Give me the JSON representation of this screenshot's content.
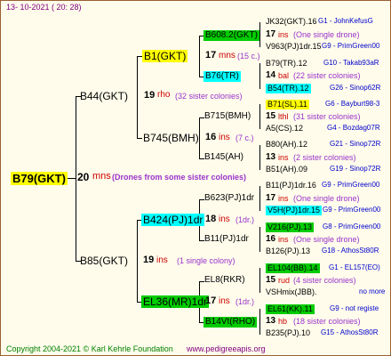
{
  "header": {
    "datetime": "13- 10-2021 ( 20: 28)"
  },
  "footer": {
    "copyright": "Copyright 2004-2021 © Karl Kehrle Foundation",
    "website": "www.pedigreeapis.org"
  },
  "colors": {
    "yellow": "#FFFF00",
    "cyan": "#00FFFF",
    "green": "#00CC00",
    "red": "#CC0000",
    "blue": "#0000CC",
    "purple": "#9933CC"
  },
  "root": {
    "id": "B79(GKT)",
    "year": "20",
    "unit": "mns",
    "note": "(Drones from some sister colonies)"
  },
  "gen1": [
    {
      "id": "B44(GKT)",
      "year": "19",
      "unit": "rho",
      "note": "(32 sister colonies)"
    },
    {
      "id": "B85(GKT)",
      "year": "19",
      "unit": "ins",
      "note": "(1 single colony)"
    }
  ],
  "gen2": [
    {
      "id": "B1(GKT)",
      "year": "17",
      "unit": "mns",
      "note": "(15 c.)"
    },
    {
      "id": "B745(BMH)",
      "year": "16",
      "unit": "ins",
      "note": "(7 c.)"
    },
    {
      "id": "B424(PJ)1dr",
      "year": "18",
      "unit": "ins",
      "note": "(1dr.)"
    },
    {
      "id": "EL36(MR)1dr",
      "year": "17",
      "unit": "ins",
      "note": "(1dr.)"
    }
  ],
  "gen3": [
    {
      "id": "B608.2(GKT)",
      "year": "17",
      "unit": "ins",
      "note": "(One single drone)"
    },
    {
      "id": "B76(TR)",
      "year": "14",
      "unit": "bal",
      "note": "(22 sister colonies)"
    },
    {
      "id": "B715(BMH)",
      "year": "15",
      "unit": "lthl",
      "note": "(31 sister colonies)"
    },
    {
      "id": "B145(AH)",
      "year": "13",
      "unit": "ins",
      "note": "(2 sister colonies)"
    },
    {
      "id": "B623(PJ)1dr",
      "year": "17",
      "unit": "ins",
      "note": "(One single drone)"
    },
    {
      "id": "B11(PJ)1dr",
      "year": "16",
      "unit": "ins",
      "note": "(One single drone)"
    },
    {
      "id": "EL8(RKR)",
      "year": "15",
      "unit": "rud",
      "note": "(4 sister colonies)"
    },
    {
      "id": "B14Vt(RHO)",
      "year": "13",
      "unit": "hb",
      "note": "(18 sister colonies)"
    }
  ],
  "gen4": [
    {
      "name": "JK32(GKT).16",
      "info": "G1 - JohnKefusG"
    },
    {
      "name": "V963(PJ)1dr.15",
      "info": "G9 - PrimGreen00"
    },
    {
      "name": "B79(TR).12",
      "info": "G10 - Takab93aR"
    },
    {
      "name": "B54(TR).12",
      "info": "G26 - Sinop62R"
    },
    {
      "name": "B71(SL).11",
      "info": "G6 - Bayburt98-3"
    },
    {
      "name": "A5(CS).12",
      "info": "G4 - Bozdag07R"
    },
    {
      "name": "B80(AH).12",
      "info": "G21 - Sinop72R"
    },
    {
      "name": "B51(AH).09",
      "info": "G19 - Sinop72R"
    },
    {
      "name": "B11(PJ)1dr.16",
      "info": "G9 - PrimGreen00"
    },
    {
      "name": "V5H(PJ)1dr.15",
      "info": "G9 - PrimGreen00"
    },
    {
      "name": "V216(PJ).13",
      "info": "G8 - PrimGreen00"
    },
    {
      "name": "B126(PJ).13",
      "info": "G18 - AthosSt80R"
    },
    {
      "name": "EL104(BB).14",
      "info": "G1 - EL157(EO)"
    },
    {
      "name": "VSHmix(JBB).",
      "info": "no more"
    },
    {
      "name": "EL61(KK).11",
      "info": "G9 - not registe"
    },
    {
      "name": "B235(PJ).10",
      "info": "G15 - AthosSt80R"
    }
  ]
}
